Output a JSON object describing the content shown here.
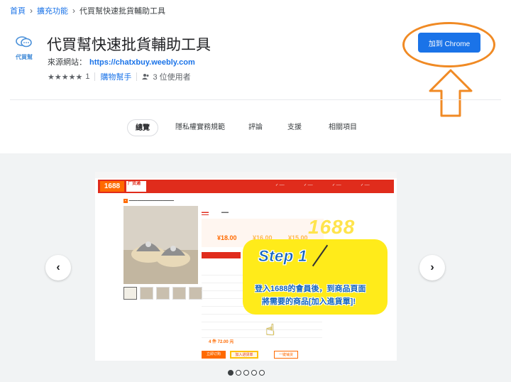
{
  "breadcrumb": {
    "home": "首頁",
    "category": "擴充功能",
    "current": "代買幫快速批貨輔助工具"
  },
  "extension": {
    "logo_text": "代買幫",
    "title": "代買幫快速批貨輔助工具",
    "source_label": "來源網站：",
    "source_url": "https://chatxbuy.weebly.com",
    "stars": "★★★★★",
    "rating_count": "1",
    "category": "購物幫手",
    "users": "3 位使用者",
    "add_button": "加到 Chrome"
  },
  "tabs": [
    {
      "label": "總覽",
      "active": true
    },
    {
      "label": "隱私權實務規範"
    },
    {
      "label": "評論"
    },
    {
      "label": "支援"
    },
    {
      "label": "相關項目"
    }
  ],
  "gallery": {
    "prev_icon": "‹",
    "next_icon": "›",
    "dot_count": 5,
    "active_dot": 0,
    "slide": {
      "site_logo": "1688",
      "site_sub": "厂货通",
      "big_logo": "1688",
      "prices": [
        "¥18.00",
        "¥16.00",
        "¥15.00"
      ],
      "total": "4 件  72.00 元",
      "buy_label": "立即订购",
      "cart_label": "加入进货单",
      "quick_label": "一键铺货",
      "step_title": "Step 1",
      "step_line1": "登入1688的會員後，到商品頁面",
      "step_line2": "將需要的商品[加入進貨單]!"
    }
  },
  "colors": {
    "accent": "#1a73e8",
    "highlight": "#f08a24",
    "bubble": "#ffeb1a",
    "site_red": "#e02c1c"
  }
}
